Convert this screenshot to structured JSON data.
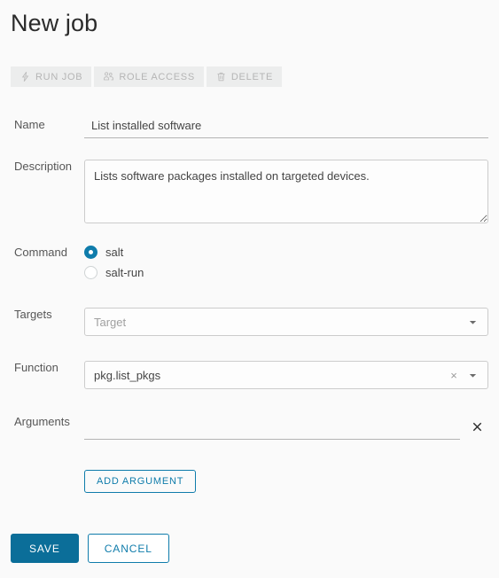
{
  "page": {
    "title": "New job"
  },
  "toolbar": {
    "buttons": [
      {
        "label": "RUN JOB",
        "icon": "lightning-bolt-icon",
        "disabled": true
      },
      {
        "label": "ROLE ACCESS",
        "icon": "users-group-icon",
        "disabled": true
      },
      {
        "label": "DELETE",
        "icon": "trash-icon",
        "disabled": true
      }
    ]
  },
  "form": {
    "name": {
      "label": "Name",
      "value": "List installed software",
      "placeholder": ""
    },
    "description": {
      "label": "Description",
      "value": "Lists software packages installed on targeted devices.",
      "placeholder": ""
    },
    "command": {
      "label": "Command",
      "selected": "salt",
      "options": [
        {
          "label": "salt",
          "checked": true
        },
        {
          "label": "salt-run",
          "checked": false
        }
      ]
    },
    "targets": {
      "label": "Targets",
      "value": "",
      "placeholder": "Target",
      "caret": "chevron-down-icon"
    },
    "function": {
      "label": "Function",
      "value": "pkg.list_pkgs",
      "placeholder": "",
      "clear": "×",
      "caret": "chevron-down-icon"
    },
    "arguments": {
      "label": "Arguments",
      "value": "",
      "placeholder": "",
      "remove_icon": "close-icon"
    },
    "add_argument_label": "ADD ARGUMENT"
  },
  "actions": {
    "save_label": "SAVE",
    "cancel_label": "CANCEL"
  },
  "colors": {
    "accent": "#0f7cab",
    "accent_solid": "#0b6e99",
    "page_background": "#fafafa",
    "label_text": "#565656",
    "value_text": "#454545",
    "disabled_text": "#b5b5b5"
  }
}
